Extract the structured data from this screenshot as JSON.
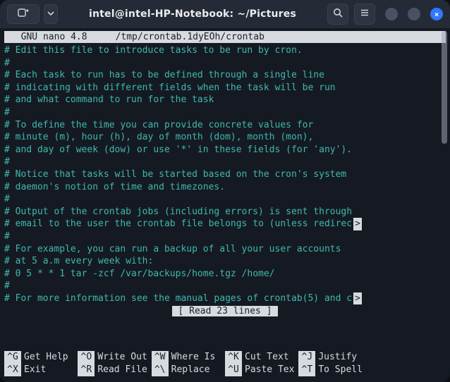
{
  "titlebar": {
    "title": "intel@intel-HP-Notebook: ~/Pictures",
    "new_tab_icon": "new-tab",
    "dropdown_icon": "chevron-down",
    "search_icon": "search",
    "menu_icon": "hamburger",
    "close_glyph": "×"
  },
  "nano": {
    "app_label": "  GNU nano 4.8",
    "file_path": "/tmp/crontab.1dyEOh/crontab",
    "status_message": "[ Read 23 lines ]",
    "truncation_mark": ">"
  },
  "file_lines": [
    {
      "t": "# Edit this file to introduce tasks to be run by cron."
    },
    {
      "t": "#"
    },
    {
      "t": "# Each task to run has to be defined through a single line"
    },
    {
      "t": "# indicating with different fields when the task will be run"
    },
    {
      "t": "# and what command to run for the task"
    },
    {
      "t": "#"
    },
    {
      "t": "# To define the time you can provide concrete values for"
    },
    {
      "t": "# minute (m), hour (h), day of month (dom), month (mon),"
    },
    {
      "t": "# and day of week (dow) or use '*' in these fields (for 'any')."
    },
    {
      "t": "#"
    },
    {
      "t": "# Notice that tasks will be started based on the cron's system"
    },
    {
      "t": "# daemon's notion of time and timezones."
    },
    {
      "t": "#"
    },
    {
      "t": "# Output of the crontab jobs (including errors) is sent through"
    },
    {
      "t": "# email to the user the crontab file belongs to (unless redirec",
      "trunc": true
    },
    {
      "t": "#"
    },
    {
      "t": "# For example, you can run a backup of all your user accounts"
    },
    {
      "t": "# at 5 a.m every week with:"
    },
    {
      "t": "# 0 5 * * 1 tar -zcf /var/backups/home.tgz /home/"
    },
    {
      "t": "#"
    },
    {
      "t": "# For more information see the manual pages of crontab(5) and c",
      "trunc": true
    }
  ],
  "shortcuts": {
    "row1": [
      {
        "k": "^G",
        "l": "Get Help"
      },
      {
        "k": "^O",
        "l": "Write Out"
      },
      {
        "k": "^W",
        "l": "Where Is"
      },
      {
        "k": "^K",
        "l": "Cut Text"
      },
      {
        "k": "^J",
        "l": "Justify"
      },
      {
        "k": "",
        "l": ""
      }
    ],
    "row2": [
      {
        "k": "^X",
        "l": "Exit"
      },
      {
        "k": "^R",
        "l": "Read File"
      },
      {
        "k": "^\\",
        "l": "Replace"
      },
      {
        "k": "^U",
        "l": "Paste Tex"
      },
      {
        "k": "^T",
        "l": "To Spell"
      },
      {
        "k": "",
        "l": ""
      }
    ]
  }
}
